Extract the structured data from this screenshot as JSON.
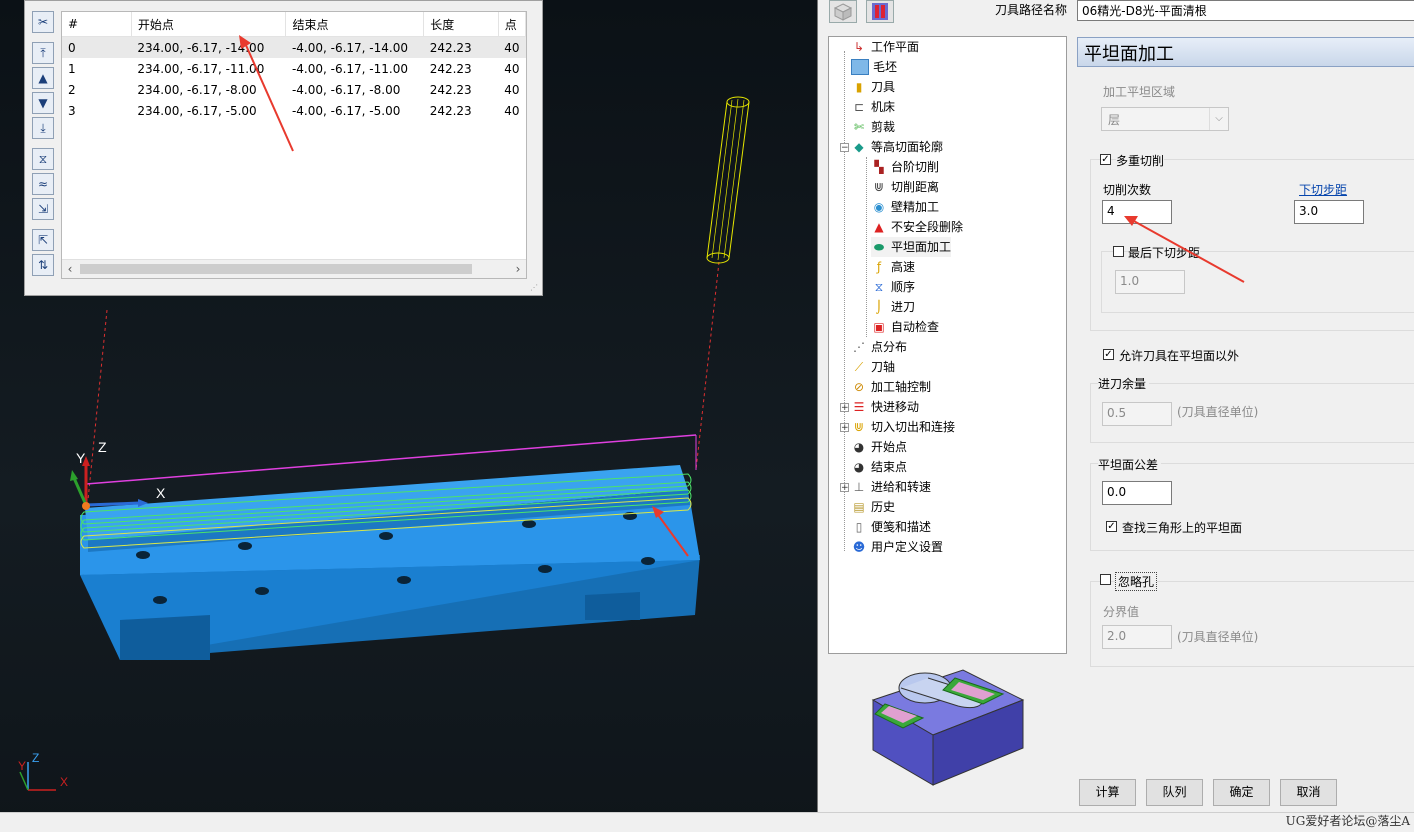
{
  "popup": {
    "table": {
      "headers": [
        "#",
        "开始点",
        "结束点",
        "长度",
        "点"
      ],
      "rows": [
        [
          "0",
          "234.00, -6.17, -14.00",
          "-4.00, -6.17, -14.00",
          "242.23",
          "40"
        ],
        [
          "1",
          "234.00, -6.17, -11.00",
          "-4.00, -6.17, -11.00",
          "242.23",
          "40"
        ],
        [
          "2",
          "234.00, -6.17, -8.00",
          "-4.00, -6.17, -8.00",
          "242.23",
          "40"
        ],
        [
          "3",
          "234.00, -6.17, -5.00",
          "-4.00, -6.17, -5.00",
          "242.23",
          "40"
        ]
      ]
    },
    "toolbar_icons": [
      "scissors-icon",
      "first-icon",
      "up-icon",
      "down-icon",
      "last-icon",
      "filter-icon",
      "wave-icon",
      "expand-icon",
      "export-icon",
      "collapse-icon"
    ]
  },
  "viewport": {
    "axis_labels": {
      "x": "X",
      "y": "Y",
      "z": "Z"
    },
    "mini_axis": {
      "x": "X",
      "y": "Y",
      "z": "Z"
    },
    "colors": {
      "part": "#1f8fe6",
      "path_top": "#e040e0",
      "path_green": "#4ce36a",
      "tool": "#e6e600",
      "arrow": "#e83a2e"
    }
  },
  "dialog": {
    "path_name_label": "刀具路径名称",
    "path_name_value": "06精光-D8光-平面清根",
    "section_title": "平坦面加工",
    "tree": [
      {
        "label": "工作平面",
        "icon": "axis-icon",
        "level": 0
      },
      {
        "label": "毛坯",
        "icon": "stock-icon",
        "level": 0
      },
      {
        "label": "刀具",
        "icon": "tool-icon",
        "level": 0
      },
      {
        "label": "机床",
        "icon": "machine-icon",
        "level": 0
      },
      {
        "label": "剪裁",
        "icon": "trim-icon",
        "level": 0
      },
      {
        "label": "等高切面轮廓",
        "icon": "layers-icon",
        "level": 0
      },
      {
        "label": "台阶切削",
        "icon": "step-icon",
        "level": 1
      },
      {
        "label": "切削距离",
        "icon": "distance-icon",
        "level": 1
      },
      {
        "label": "壁精加工",
        "icon": "wall-icon",
        "level": 1
      },
      {
        "label": "不安全段删除",
        "icon": "unsafe-icon",
        "level": 1
      },
      {
        "label": "平坦面加工",
        "icon": "flat-icon",
        "level": 1,
        "selected": true
      },
      {
        "label": "高速",
        "icon": "speed-icon",
        "level": 1
      },
      {
        "label": "顺序",
        "icon": "order-icon",
        "level": 1
      },
      {
        "label": "进刀",
        "icon": "leadin-icon",
        "level": 1
      },
      {
        "label": "自动检查",
        "icon": "check-icon",
        "level": 1
      },
      {
        "label": "点分布",
        "icon": "points-icon",
        "level": 0
      },
      {
        "label": "刀轴",
        "icon": "toolaxis-icon",
        "level": 0
      },
      {
        "label": "加工轴控制",
        "icon": "axis-control-icon",
        "level": 0
      },
      {
        "label": "快进移动",
        "icon": "rapid-icon",
        "level": 0,
        "expander": true
      },
      {
        "label": "切入切出和连接",
        "icon": "links-icon",
        "level": 0,
        "expander": true
      },
      {
        "label": "开始点",
        "icon": "start-icon",
        "level": 0
      },
      {
        "label": "结束点",
        "icon": "end-icon",
        "level": 0
      },
      {
        "label": "进给和转速",
        "icon": "feed-icon",
        "level": 0,
        "expander": true
      },
      {
        "label": "历史",
        "icon": "history-icon",
        "level": 0
      },
      {
        "label": "便笺和描述",
        "icon": "notes-icon",
        "level": 0
      },
      {
        "label": "用户定义设置",
        "icon": "user-settings-icon",
        "level": 0
      }
    ],
    "flat_area_label": "加工平坦区域",
    "flat_area_value": "层",
    "multi_cut_label": "多重切削",
    "multi_cut_checked": true,
    "cut_count_label": "切削次数",
    "cut_count_value": "4",
    "stepdown_label": "下切步距",
    "stepdown_value": "3.0",
    "last_stepdown_label": "最后下切步距",
    "last_stepdown_checked": false,
    "last_stepdown_value": "1.0",
    "allow_tool_label": "允许刀具在平坦面以外",
    "allow_tool_checked": true,
    "approach_label": "进刀余量",
    "approach_value": "0.5",
    "approach_unit": "(刀具直径单位)",
    "tolerance_label": "平坦面公差",
    "tolerance_value": "0.0",
    "find_tri_label": "查找三角形上的平坦面",
    "find_tri_checked": true,
    "ignore_holes_label": "忽略孔",
    "ignore_holes_checked": false,
    "threshold_label": "分界值",
    "threshold_value": "2.0",
    "threshold_unit": "(刀具直径单位)",
    "buttons": {
      "calc": "计算",
      "queue": "队列",
      "ok": "确定",
      "cancel": "取消"
    }
  },
  "watermark": "UG爱好者论坛@落尘A"
}
